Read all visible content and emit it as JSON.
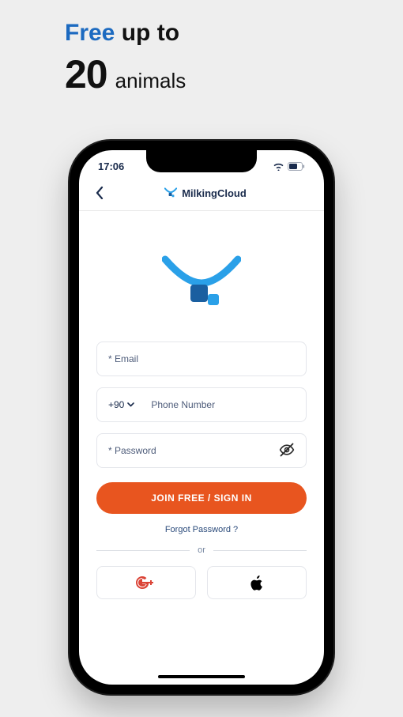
{
  "headline": {
    "free": "Free",
    "up_to": "up to",
    "number": "20",
    "animals": "animals"
  },
  "status": {
    "time": "17:06"
  },
  "header": {
    "app_name": "MilkingCloud"
  },
  "form": {
    "email_placeholder": "* Email",
    "country_code": "+90",
    "phone_placeholder": "Phone Number",
    "password_placeholder": "* Password",
    "join_label": "JOIN FREE / SIGN IN",
    "forgot_label": "Forgot Password ?",
    "or_label": "or"
  },
  "colors": {
    "accent_blue": "#1c6ac0",
    "dark_navy": "#1a2b4c",
    "orange": "#e8551f"
  }
}
